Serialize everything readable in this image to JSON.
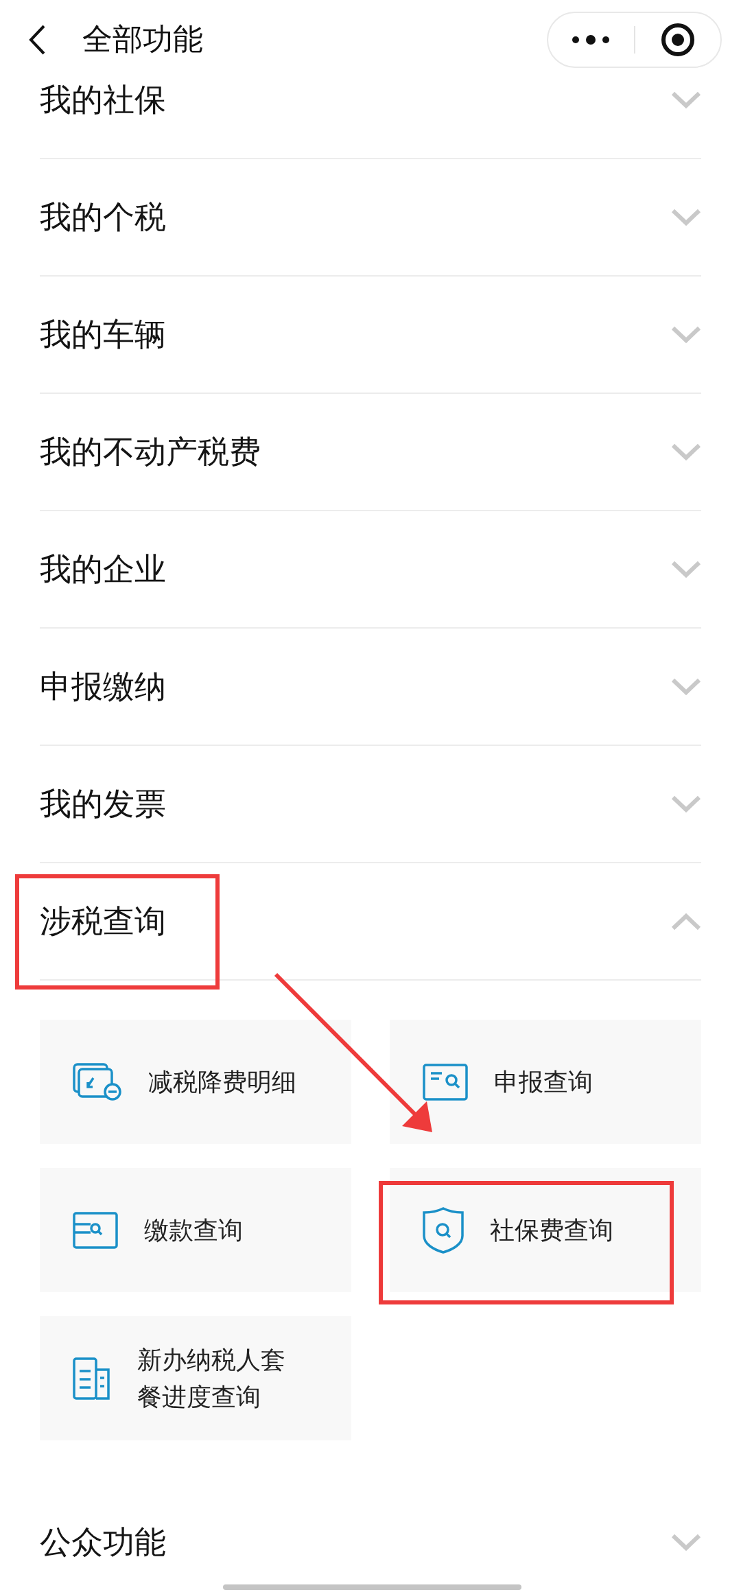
{
  "header": {
    "title": "全部功能"
  },
  "sections": [
    {
      "title": "我的社保",
      "expanded": false,
      "highlighted": false
    },
    {
      "title": "我的个税",
      "expanded": false,
      "highlighted": false
    },
    {
      "title": "我的车辆",
      "expanded": false,
      "highlighted": false
    },
    {
      "title": "我的不动产税费",
      "expanded": false,
      "highlighted": false
    },
    {
      "title": "我的企业",
      "expanded": false,
      "highlighted": false
    },
    {
      "title": "申报缴纳",
      "expanded": false,
      "highlighted": false
    },
    {
      "title": "我的发票",
      "expanded": false,
      "highlighted": false
    },
    {
      "title": "涉税查询",
      "expanded": true,
      "highlighted": true,
      "items": [
        {
          "label": "减税降费明细",
          "kind": "reduction",
          "highlighted": false
        },
        {
          "label": "申报查询",
          "kind": "declaration",
          "highlighted": false
        },
        {
          "label": "缴款查询",
          "kind": "payment",
          "highlighted": false
        },
        {
          "label": "社保费查询",
          "kind": "shield",
          "highlighted": true
        },
        {
          "label": "新办纳税人套餐进度查询",
          "kind": "building",
          "highlighted": false
        }
      ]
    },
    {
      "title": "公众功能",
      "expanded": false,
      "highlighted": false
    }
  ]
}
